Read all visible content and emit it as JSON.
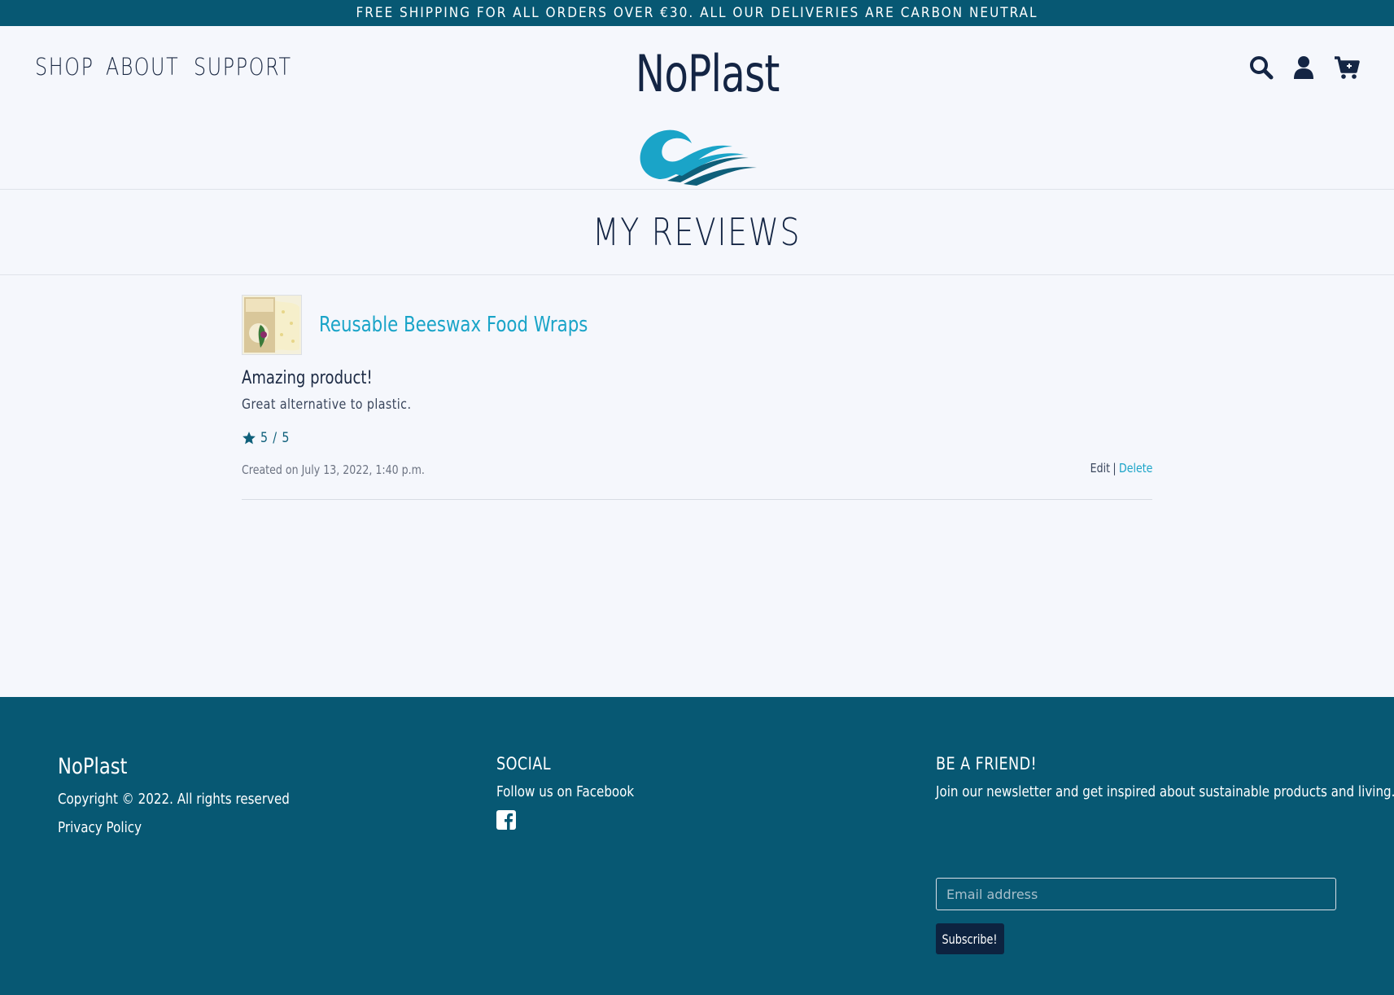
{
  "announcement": "FREE SHIPPING FOR ALL ORDERS OVER €30. ALL OUR DELIVERIES ARE CARBON NEUTRAL",
  "nav": {
    "items": [
      {
        "label": "SHOP"
      },
      {
        "label": "ABOUT"
      },
      {
        "label": "SUPPORT"
      }
    ]
  },
  "brand": {
    "name": "NoPlast"
  },
  "header_icons": [
    "search-icon",
    "user-icon",
    "cart-icon"
  ],
  "page": {
    "title": "MY REVIEWS"
  },
  "review": {
    "product_name": "Reusable Beeswax Food Wraps",
    "title": "Amazing product!",
    "body": "Great alternative to plastic.",
    "rating": "5 / 5",
    "created": "Created on July 13, 2022, 1:40 p.m.",
    "edit_label": "Edit",
    "separator": "|",
    "delete_label": "Delete"
  },
  "footer": {
    "brand": "NoPlast",
    "copyright": "Copyright © 2022. All rights reserved",
    "privacy": "Privacy Policy",
    "social_heading": "SOCIAL",
    "social_text": "Follow us on Facebook",
    "newsletter_heading": "BE A FRIEND!",
    "newsletter_text": "Join our newsletter and get inspired about sustainable products and living.",
    "email_placeholder": "Email address",
    "subscribe_label": "Subscribe!"
  },
  "colors": {
    "primary": "#075873",
    "accent": "#1aa4c8",
    "dark": "#0d2340",
    "background": "#f5f7fc"
  }
}
